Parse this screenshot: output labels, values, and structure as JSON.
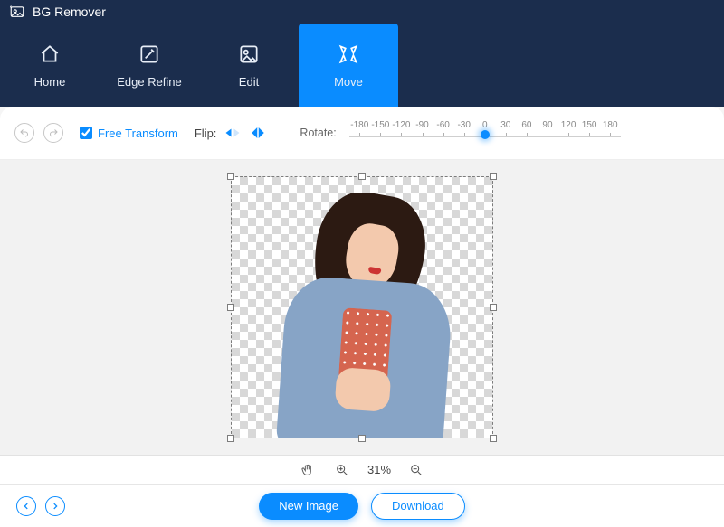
{
  "brand": {
    "title": "BG Remover"
  },
  "tabs": {
    "home": {
      "label": "Home"
    },
    "edge": {
      "label": "Edge Refine"
    },
    "edit": {
      "label": "Edit"
    },
    "move": {
      "label": "Move"
    },
    "active": "move"
  },
  "toolbar": {
    "free_transform_label": "Free Transform",
    "free_transform_checked": true,
    "flip_label": "Flip:",
    "rotate_label": "Rotate:",
    "rotate_value": 0,
    "rotate_ticks": [
      "-180",
      "-150",
      "-120",
      "-90",
      "-60",
      "-30",
      "0",
      "30",
      "60",
      "90",
      "120",
      "150",
      "180"
    ]
  },
  "zoom": {
    "value_text": "31%",
    "value": 31
  },
  "footer": {
    "new_image_label": "New Image",
    "download_label": "Download"
  },
  "colors": {
    "accent": "#0a8cff",
    "header": "#1b2d4d"
  }
}
